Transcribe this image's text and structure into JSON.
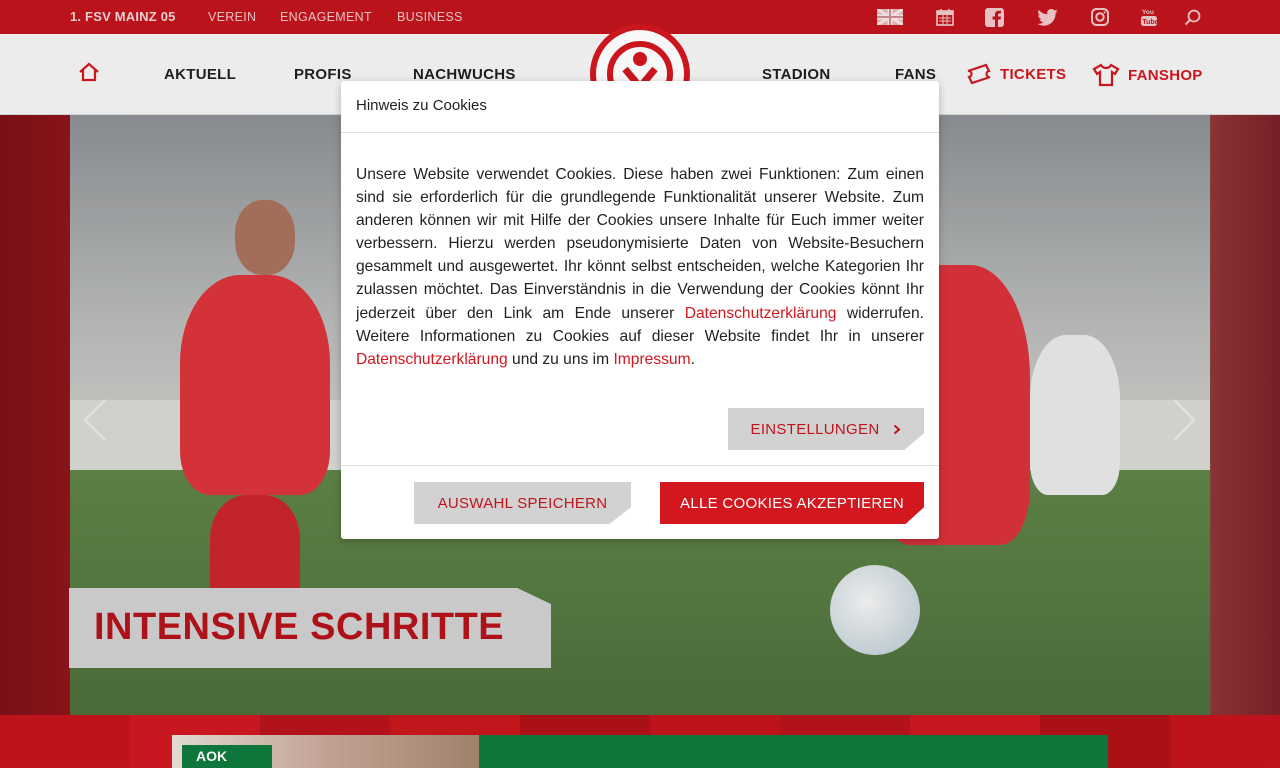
{
  "topbar": {
    "brand": "1. FSV MAINZ 05",
    "links": [
      "VEREIN",
      "ENGAGEMENT",
      "BUSINESS"
    ],
    "icons": [
      "uk-flag-icon",
      "calendar-icon",
      "facebook-icon",
      "twitter-icon",
      "instagram-icon",
      "youtube-icon",
      "search-icon"
    ]
  },
  "nav": {
    "items": [
      "AKTUELL",
      "PROFIS",
      "NACHWUCHS",
      "STADION",
      "FANS"
    ],
    "tickets": "TICKETS",
    "fanshop": "FANSHOP"
  },
  "hero": {
    "headline": "INTENSIVE SCHRITTE"
  },
  "ad": {
    "brand": "AOK"
  },
  "cookie_dialog": {
    "title": "Hinweis zu Cookies",
    "text_1": "Unsere Website verwendet Cookies. Diese haben zwei Funktionen: Zum einen sind sie erforderlich für die grundlegende Funktionalität unserer Website. Zum anderen können wir mit Hilfe der Cookies unsere Inhalte für Euch immer weiter verbessern. Hierzu werden pseudonymisierte Daten von Website-Besuchern gesammelt und ausgewertet. Ihr könnt selbst entscheiden, welche Kategorien Ihr zulassen möchtet. Das Einverständnis in die Verwendung der Cookies könnt Ihr jederzeit über den Link am Ende unserer ",
    "link_1": "Datenschutzerklärung",
    "text_2": " widerrufen. Weitere Informationen zu Cookies auf dieser Website findet Ihr in unserer ",
    "link_2": "Datenschutzerklärung",
    "text_3": " und zu uns im ",
    "link_3": "Impressum",
    "text_4": ".",
    "settings_button": "EINSTELLUNGEN",
    "save_button": "AUSWAHL SPEICHERN",
    "accept_all_button": "ALLE COOKIES AKZEPTIEREN"
  },
  "colors": {
    "brand_red": "#d2171f",
    "topbar_red": "#c0141c",
    "button_gray": "#d2d2d2"
  }
}
